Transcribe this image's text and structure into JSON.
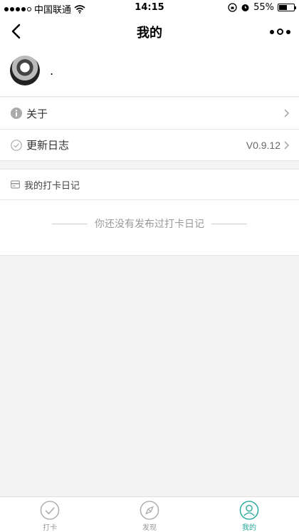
{
  "status_bar": {
    "carrier": "中国联通",
    "time": "14:15",
    "battery": "55%",
    "battery_level": 0.55
  },
  "nav": {
    "title": "我的",
    "back_icon": "chevron-left-icon",
    "more_icon": "more-dots-icon"
  },
  "profile": {
    "nickname": "."
  },
  "menu": {
    "items": [
      {
        "label": "关于",
        "value": "",
        "icon": "info-icon"
      },
      {
        "label": "更新日志",
        "value": "V0.9.12",
        "icon": "check-circle-icon"
      }
    ]
  },
  "diary": {
    "title": "我的打卡日记",
    "empty_text": "你还没有发布过打卡日记"
  },
  "tabs": [
    {
      "label": "打卡",
      "icon": "check-circle-icon",
      "active": false
    },
    {
      "label": "发现",
      "icon": "compass-icon",
      "active": false
    },
    {
      "label": "我的",
      "icon": "user-icon",
      "active": true
    }
  ],
  "colors": {
    "active_tab": "#23a89a",
    "inactive_tab": "#999999",
    "background": "#f4f4f4"
  }
}
